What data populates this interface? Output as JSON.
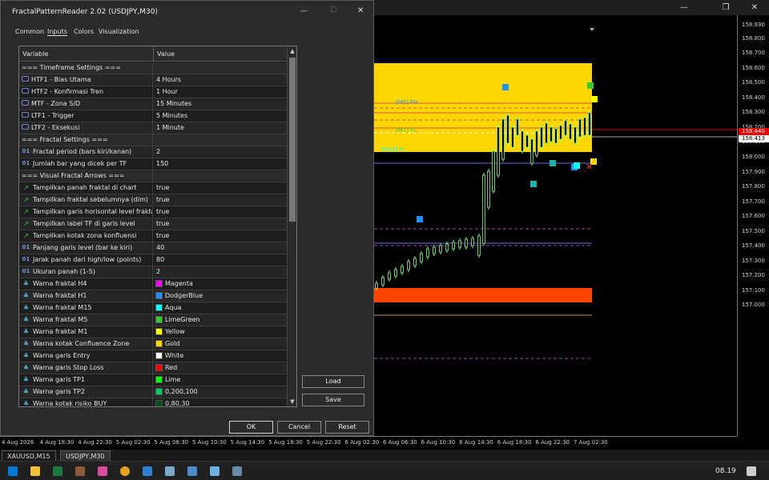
{
  "dialog": {
    "title": "FractalPatternReader 2.02 (USDJPY,M30)",
    "minimize": "—",
    "maximize": "☐",
    "close": "✕",
    "tabs": [
      "Common",
      "Inputs",
      "Colors",
      "Visualization"
    ],
    "active_tab": "Inputs",
    "table_headers": {
      "variable": "Variable",
      "value": "Value"
    },
    "rows": [
      {
        "variable": "=== Timeframe Settings ===",
        "value": "",
        "icon": "none"
      },
      {
        "variable": "HTF1 - Bias Utama",
        "value": "4 Hours",
        "icon": "timeframe-icon"
      },
      {
        "variable": "HTF2 - Konfirmasi Tren",
        "value": "1 Hour",
        "icon": "timeframe-icon"
      },
      {
        "variable": "MTF  - Zona S/D",
        "value": "15 Minutes",
        "icon": "timeframe-icon"
      },
      {
        "variable": "LTF1 - Trigger",
        "value": "5 Minutes",
        "icon": "timeframe-icon"
      },
      {
        "variable": "LTF2 - Eksekusi",
        "value": "1 Minute",
        "icon": "timeframe-icon"
      },
      {
        "variable": "=== Fractal Settings ===",
        "value": "",
        "icon": "none"
      },
      {
        "variable": "Fractal period (bars kiri/kanan)",
        "value": "2",
        "icon": "integer-icon"
      },
      {
        "variable": "Jumlah bar yang dicek per TF",
        "value": "150",
        "icon": "integer-icon"
      },
      {
        "variable": "=== Visual Fractal Arrows ===",
        "value": "",
        "icon": "none"
      },
      {
        "variable": "Tampilkan panah fraktal di chart",
        "value": "true",
        "icon": "bool-icon"
      },
      {
        "variable": "Tampilkan fraktal sebelumnya (dim)",
        "value": "true",
        "icon": "bool-icon"
      },
      {
        "variable": "Tampilkan garis horisontal level fraktal",
        "value": "true",
        "icon": "bool-icon"
      },
      {
        "variable": "Tampilkan label TF di garis level",
        "value": "true",
        "icon": "bool-icon"
      },
      {
        "variable": "Tampilkan kotak zona konfluensi",
        "value": "true",
        "icon": "bool-icon"
      },
      {
        "variable": "Panjang garis level (bar ke kiri)",
        "value": "40",
        "icon": "integer-icon"
      },
      {
        "variable": "Jarak panah dari high/low (points)",
        "value": "80",
        "icon": "integer-icon"
      },
      {
        "variable": "Ukuran panah (1-5)",
        "value": "2",
        "icon": "integer-icon"
      },
      {
        "variable": "Warna fraktal H4",
        "value": "Magenta",
        "icon": "color-icon",
        "swatch": "#ff00ff"
      },
      {
        "variable": "Warna fraktal H1",
        "value": "DodgerBlue",
        "icon": "color-icon",
        "swatch": "#1e90ff"
      },
      {
        "variable": "Warna fraktal M15",
        "value": "Aqua",
        "icon": "color-icon",
        "swatch": "#00ffff"
      },
      {
        "variable": "Warna fraktal M5",
        "value": "LimeGreen",
        "icon": "color-icon",
        "swatch": "#32cd32"
      },
      {
        "variable": "Warna fraktal M1",
        "value": "Yellow",
        "icon": "color-icon",
        "swatch": "#ffff00"
      },
      {
        "variable": "Warna kotak Confluence Zone",
        "value": "Gold",
        "icon": "color-icon",
        "swatch": "#ffd700"
      },
      {
        "variable": "Warna garis Entry",
        "value": "White",
        "icon": "color-icon",
        "swatch": "#ffffff"
      },
      {
        "variable": "Warna garis Stop Loss",
        "value": "Red",
        "icon": "color-icon",
        "swatch": "#ff0000"
      },
      {
        "variable": "Warna garis TP1",
        "value": "Lime",
        "icon": "color-icon",
        "swatch": "#00ff00"
      },
      {
        "variable": "Warna garis TP2",
        "value": "0,200,100",
        "icon": "color-icon",
        "swatch": "#00c864"
      },
      {
        "variable": "Warna kotak risiko BUY",
        "value": "0,80,30",
        "icon": "color-icon",
        "swatch": "#00501e"
      }
    ],
    "buttons": {
      "load": "Load",
      "save": "Save",
      "ok": "OK",
      "cancel": "Cancel",
      "reset": "Reset"
    }
  },
  "chart": {
    "price_labels": [
      "158.930",
      "158.800",
      "158.700",
      "158.600",
      "158.500",
      "158.400",
      "158.300",
      "158.200",
      "158.100",
      "158.000",
      "157.900",
      "157.800",
      "157.700",
      "157.600",
      "157.500",
      "157.400",
      "157.300",
      "157.200",
      "157.100",
      "157.000"
    ],
    "current_price_red": "158.440",
    "current_price_white": "158.413",
    "time_labels": [
      "4 Aug 2026",
      "4 Aug 18:30",
      "4 Aug 22:30",
      "5 Aug 02:30",
      "5 Aug 06:30",
      "5 Aug 10:30",
      "5 Aug 14:30",
      "5 Aug 18:30",
      "5 Aug 22:30",
      "6 Aug 02:30",
      "6 Aug 06:30",
      "6 Aug 10:30",
      "6 Aug 14:30",
      "6 Aug 18:30",
      "6 Aug 22:30",
      "7 Aug 02:30"
    ],
    "level_labels": [
      "[M5] FH",
      "[M1] FL",
      "[M15] FL"
    ],
    "zone_color": "#ffd700",
    "sell_zone_color": "#ff4500"
  },
  "chart_tabs": [
    "XAUUSD,M15",
    "USDJPY,M30"
  ],
  "active_chart_tab": "USDJPY,M30",
  "window_controls": {
    "minimize": "—",
    "restore": "❐",
    "close": "✕"
  },
  "taskbar": {
    "time": "08.19"
  }
}
